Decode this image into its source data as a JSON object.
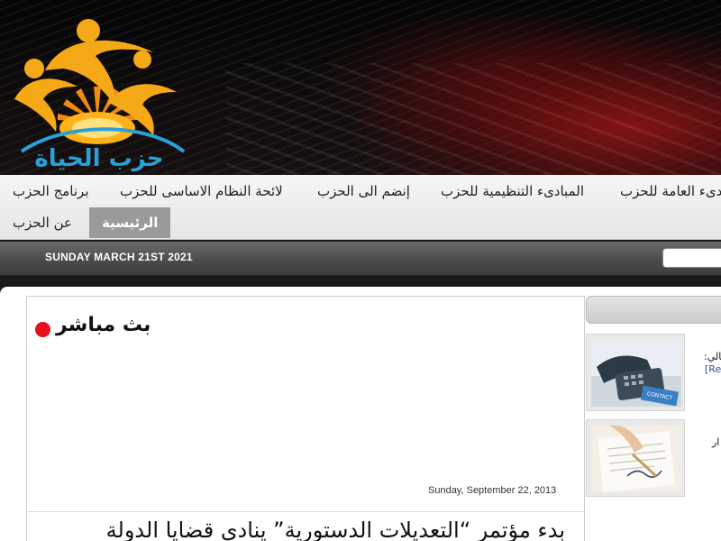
{
  "header": {
    "logo_text": "حزب الحياة"
  },
  "nav": {
    "row1": [
      {
        "label": "برنامج الحزب"
      },
      {
        "label": "لائحة النظام الاساسى للحزب"
      },
      {
        "label": "إنضم الى الحزب"
      },
      {
        "label": "المبادىء التنظيمية للحزب"
      },
      {
        "label": "المبادىء العامة للحزب"
      }
    ],
    "row2": [
      {
        "label": "عن الحزب"
      },
      {
        "label": "الرئيسية",
        "active": true
      }
    ]
  },
  "datebar": {
    "date": "SUNDAY MARCH 21ST 2021",
    "search_placeholder": ""
  },
  "main": {
    "live_label": "بث مباشر",
    "post_date": "Sunday, September 22, 2013",
    "post_title": "بدء مؤتمر “التعديلات الدستورية” ينادي قضايا الدولة"
  },
  "sidebar": {
    "items": [
      {
        "icon": "phone-contact-us-thumbnail",
        "text": "الحالي:",
        "link": "[Re"
      },
      {
        "icon": "signing-document-thumbnail",
        "text": "ار"
      }
    ],
    "colors": {
      "accent": "#e8101a",
      "nav_active": "#9a9a9a",
      "link": "#2a55a8"
    }
  }
}
